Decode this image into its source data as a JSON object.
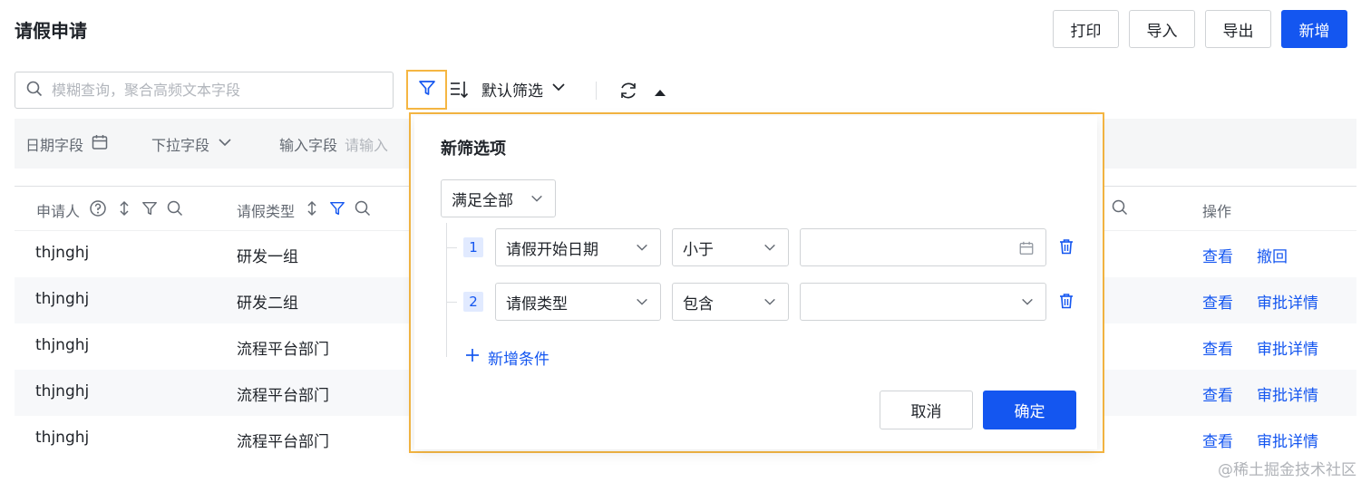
{
  "page": {
    "title": "请假申请"
  },
  "toolbar": {
    "print": "打印",
    "import": "导入",
    "export": "导出",
    "add": "新增"
  },
  "search": {
    "placeholder": "模糊查询，聚合高频文本字段",
    "value": ""
  },
  "view_controls": {
    "default_filter": "默认筛选"
  },
  "filter_bar": {
    "date_field": "日期字段",
    "dropdown_field": "下拉字段",
    "input_field": "输入字段",
    "input_placeholder": "请输入"
  },
  "table": {
    "columns": {
      "applicant": "申请人",
      "leave_type": "请假类型",
      "actions": "操作"
    },
    "rows": [
      {
        "applicant": "thjnghj",
        "leave_type": "研发一组",
        "action1": "查看",
        "action2": "撤回"
      },
      {
        "applicant": "thjnghj",
        "leave_type": "研发二组",
        "action1": "查看",
        "action2": "审批详情"
      },
      {
        "applicant": "thjnghj",
        "leave_type": "流程平台部门",
        "action1": "查看",
        "action2": "审批详情"
      },
      {
        "applicant": "thjnghj",
        "leave_type": "流程平台部门",
        "action1": "查看",
        "action2": "审批详情"
      },
      {
        "applicant": "thjnghj",
        "leave_type": "流程平台部门",
        "action1": "查看",
        "action2": "审批详情"
      }
    ]
  },
  "popup": {
    "title": "新筛选项",
    "match_mode": "满足全部",
    "conditions": [
      {
        "index": "1",
        "field": "请假开始日期",
        "operator": "小于",
        "value": ""
      },
      {
        "index": "2",
        "field": "请假类型",
        "operator": "包含",
        "value": ""
      }
    ],
    "add_condition": "新增条件",
    "cancel": "取消",
    "confirm": "确定"
  },
  "watermark": "@稀土掘金技术社区",
  "colors": {
    "primary": "#1456f0",
    "highlight": "#f5b642",
    "text": "#1f2329",
    "muted": "#646a73"
  }
}
